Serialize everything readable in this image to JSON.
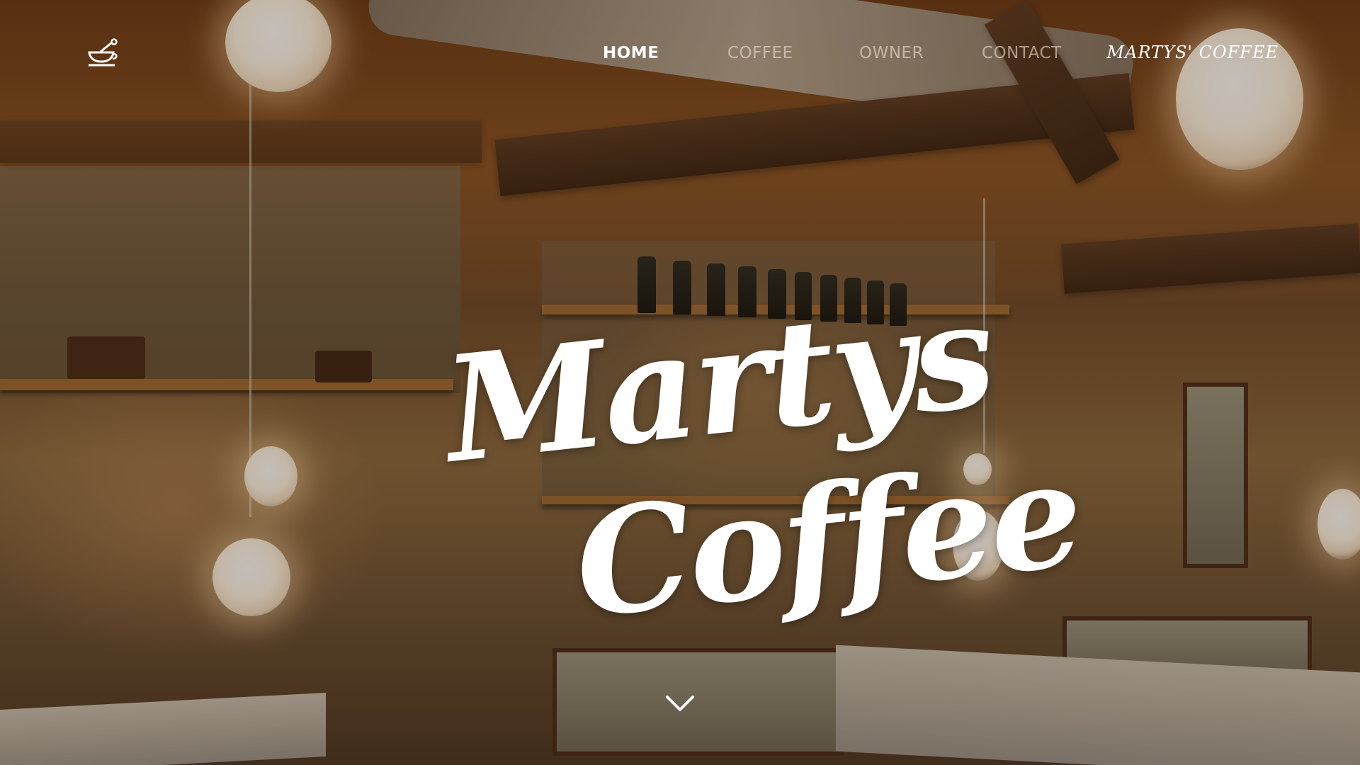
{
  "nav": {
    "logo_icon": "mortar-cup-icon",
    "links": [
      {
        "label": "HOME",
        "active": true
      },
      {
        "label": "COFFEE",
        "active": false
      },
      {
        "label": "OWNER",
        "active": false
      },
      {
        "label": "CONTACT",
        "active": false
      }
    ],
    "brand": "MARTYS' COFFEE"
  },
  "hero": {
    "title_line_1": "Martys",
    "title_line_2": "Coffee",
    "scroll_icon": "chevron-down-icon"
  },
  "colors": {
    "nav_active": "#ffffff",
    "nav_inactive": "#b9aea0",
    "title": "#ffffff"
  }
}
